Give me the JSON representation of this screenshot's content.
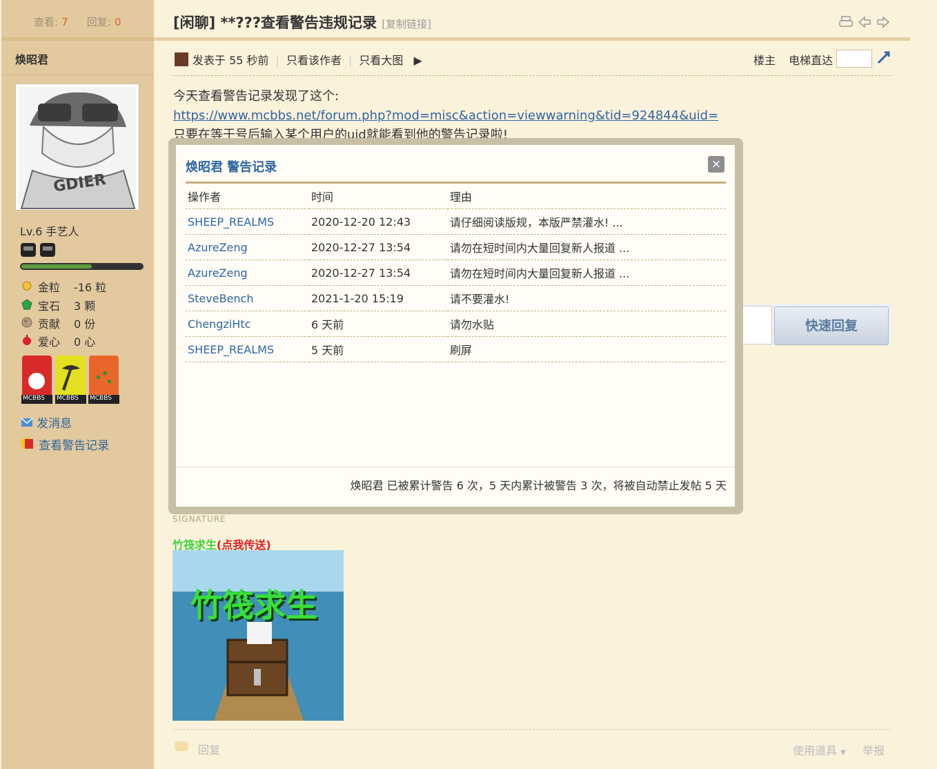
{
  "stats": {
    "views_label": "查看:",
    "views": "7",
    "replies_label": "回复:",
    "replies": "0"
  },
  "thread": {
    "title": "[闲聊] **???查看警告违规记录",
    "copy_link": "[复制链接]"
  },
  "author": {
    "name": "焕昭君",
    "level": "Lv.6 手艺人",
    "exp_progress": 0.58,
    "stats": [
      {
        "icon": "gold-nugget-icon",
        "label": "金粒",
        "value": "-16 粒"
      },
      {
        "icon": "emerald-icon",
        "label": "宝石",
        "value": "3 颗"
      },
      {
        "icon": "contribution-icon",
        "label": "贡献",
        "value": "0 份"
      },
      {
        "icon": "heart-apple-icon",
        "label": "爱心",
        "value": "0 心"
      }
    ],
    "medal_text": "MCBBS",
    "send_message": "发消息",
    "view_warnings": "查看警告记录"
  },
  "post_meta": {
    "posted": "发表于 55 秒前",
    "only_author": "只看该作者",
    "only_big_image": "只看大图",
    "floor": "楼主",
    "elevator": "电梯直达"
  },
  "content": {
    "line1": "今天查看警告记录发现了这个:",
    "url": "https://www.mcbbs.net/forum.php?mod=misc&action=viewwarning&tid=924844&uid=",
    "line3": "只要在等于号后输入某个用户的uid就能看到他的警告记录啦!"
  },
  "modal": {
    "title": "焕昭君 警告记录",
    "close": "×",
    "columns": [
      "操作者",
      "时间",
      "理由"
    ],
    "rows": [
      {
        "operator": "SHEEP_REALMS",
        "time": "2020-12-20 12:43",
        "reason": "请仔细阅读版规，本版严禁灌水!  ..."
      },
      {
        "operator": "AzureZeng",
        "time": "2020-12-27 13:54",
        "reason": "请勿在短时间内大量回复新人报道 ..."
      },
      {
        "operator": "AzureZeng",
        "time": "2020-12-27 13:54",
        "reason": "请勿在短时间内大量回复新人报道 ..."
      },
      {
        "operator": "SteveBench",
        "time": "2021-1-20 15:19",
        "reason": "请不要灌水!"
      },
      {
        "operator": "ChengziHtc",
        "time": "6 天前",
        "reason": "请勿水贴"
      },
      {
        "operator": "SHEEP_REALMS",
        "time": "5 天前",
        "reason": "刷屏"
      }
    ],
    "footer": "焕昭君 已被累计警告 6 次，5 天内累计被警告 3 次，将被自动禁止发帖 5 天"
  },
  "quick_reply": "快速回复",
  "signature": {
    "label": "SIGNATURE",
    "link_green": "竹筏求生",
    "link_red": "(点我传送)",
    "image_title": "竹筏求生"
  },
  "footer": {
    "reply": "回复",
    "use_item": "使用道具",
    "report": "举报"
  }
}
